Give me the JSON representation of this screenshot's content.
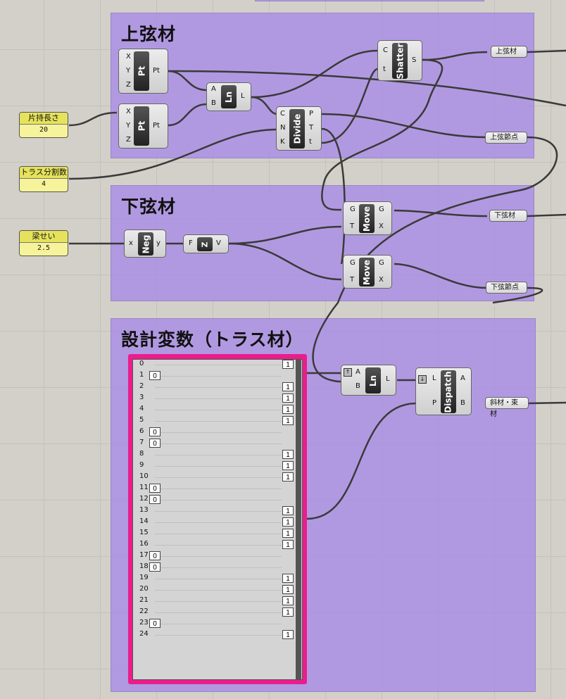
{
  "groups": {
    "top_chord": {
      "title": "上弦材"
    },
    "bottom_chord": {
      "title": "下弦材"
    },
    "design_vars": {
      "title": "設計変数（トラス材）"
    }
  },
  "sliders": {
    "cantilever": {
      "label": "片持長さ",
      "value": "20"
    },
    "divisions": {
      "label": "トラス分割数",
      "value": "4"
    },
    "depth": {
      "label": "梁せい",
      "value": "2.5"
    }
  },
  "components": {
    "pt1": {
      "name": "Pt",
      "inputs": [
        "X",
        "Y",
        "Z"
      ],
      "output": "Pt"
    },
    "pt2": {
      "name": "Pt",
      "inputs": [
        "X",
        "Y",
        "Z"
      ],
      "output": "Pt"
    },
    "ln1": {
      "name": "Ln",
      "inputs": [
        "A",
        "B"
      ],
      "output": "L"
    },
    "divide": {
      "name": "Divide",
      "inputs": [
        "C",
        "N",
        "K"
      ],
      "outputs": [
        "P",
        "T",
        "t"
      ]
    },
    "shatter": {
      "name": "Shatter",
      "inputs": [
        "C",
        "t"
      ],
      "output": "S"
    },
    "neg": {
      "name": "Neg",
      "input": "x",
      "output": "y"
    },
    "unitz": {
      "name": "Z",
      "input": "F",
      "output": "V"
    },
    "move1": {
      "name": "Move",
      "inputs": [
        "G",
        "T"
      ],
      "outputs": [
        "G",
        "X"
      ]
    },
    "move2": {
      "name": "Move",
      "inputs": [
        "G",
        "T"
      ],
      "outputs": [
        "G",
        "X"
      ]
    },
    "ln2": {
      "name": "Ln",
      "inputs": [
        "A",
        "B"
      ],
      "output": "L"
    },
    "dispatch": {
      "name": "Dispatch",
      "inputs": [
        "L",
        "P"
      ],
      "outputs": [
        "A",
        "B"
      ]
    }
  },
  "labels": {
    "top_chord": "上弦材",
    "top_nodes": "上弦節点",
    "bottom_chord": "下弦材",
    "bottom_nodes": "下弦節点",
    "diagonals": "斜材・束材"
  },
  "gene_pool": {
    "rows": [
      {
        "index": "0",
        "value": "1"
      },
      {
        "index": "1",
        "value": "0"
      },
      {
        "index": "2",
        "value": "1"
      },
      {
        "index": "3",
        "value": "1"
      },
      {
        "index": "4",
        "value": "1"
      },
      {
        "index": "5",
        "value": "1"
      },
      {
        "index": "6",
        "value": "0"
      },
      {
        "index": "7",
        "value": "0"
      },
      {
        "index": "8",
        "value": "1"
      },
      {
        "index": "9",
        "value": "1"
      },
      {
        "index": "10",
        "value": "1"
      },
      {
        "index": "11",
        "value": "0"
      },
      {
        "index": "12",
        "value": "0"
      },
      {
        "index": "13",
        "value": "1"
      },
      {
        "index": "14",
        "value": "1"
      },
      {
        "index": "15",
        "value": "1"
      },
      {
        "index": "16",
        "value": "1"
      },
      {
        "index": "17",
        "value": "0"
      },
      {
        "index": "18",
        "value": "0"
      },
      {
        "index": "19",
        "value": "1"
      },
      {
        "index": "20",
        "value": "1"
      },
      {
        "index": "21",
        "value": "1"
      },
      {
        "index": "22",
        "value": "1"
      },
      {
        "index": "23",
        "value": "0"
      },
      {
        "index": "24",
        "value": "1"
      }
    ]
  },
  "colors": {
    "group": "#a98ce6",
    "gene_border": "#ec1c8c",
    "slider": "#f6f39a"
  }
}
